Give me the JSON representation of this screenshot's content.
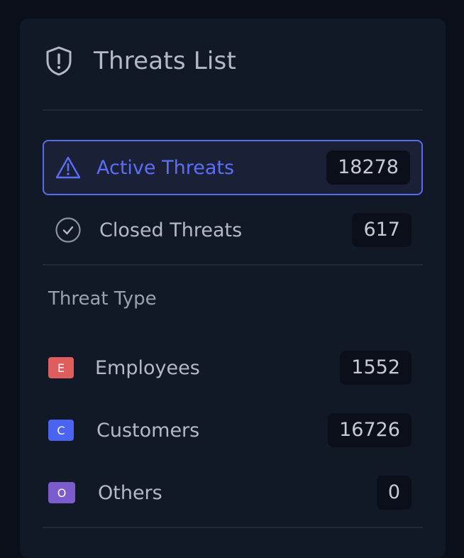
{
  "panel": {
    "title": "Threats List",
    "icon": "shield-alert-icon"
  },
  "status_filters": [
    {
      "label": "Active Threats",
      "count": "18278",
      "icon": "warning-triangle-icon",
      "active": true
    },
    {
      "label": "Closed Threats",
      "count": "617",
      "icon": "check-circle-icon",
      "active": false
    }
  ],
  "threat_type": {
    "title": "Threat Type",
    "items": [
      {
        "badge": "E",
        "label": "Employees",
        "count": "1552",
        "color": "#e05d5d"
      },
      {
        "badge": "C",
        "label": "Customers",
        "count": "16726",
        "color": "#4a63f0"
      },
      {
        "badge": "O",
        "label": "Others",
        "count": "0",
        "color": "#7c5ccc"
      }
    ]
  },
  "colors": {
    "accent": "#5b6ef5",
    "panel_bg": "#121926",
    "page_bg": "#0b0f1a"
  }
}
